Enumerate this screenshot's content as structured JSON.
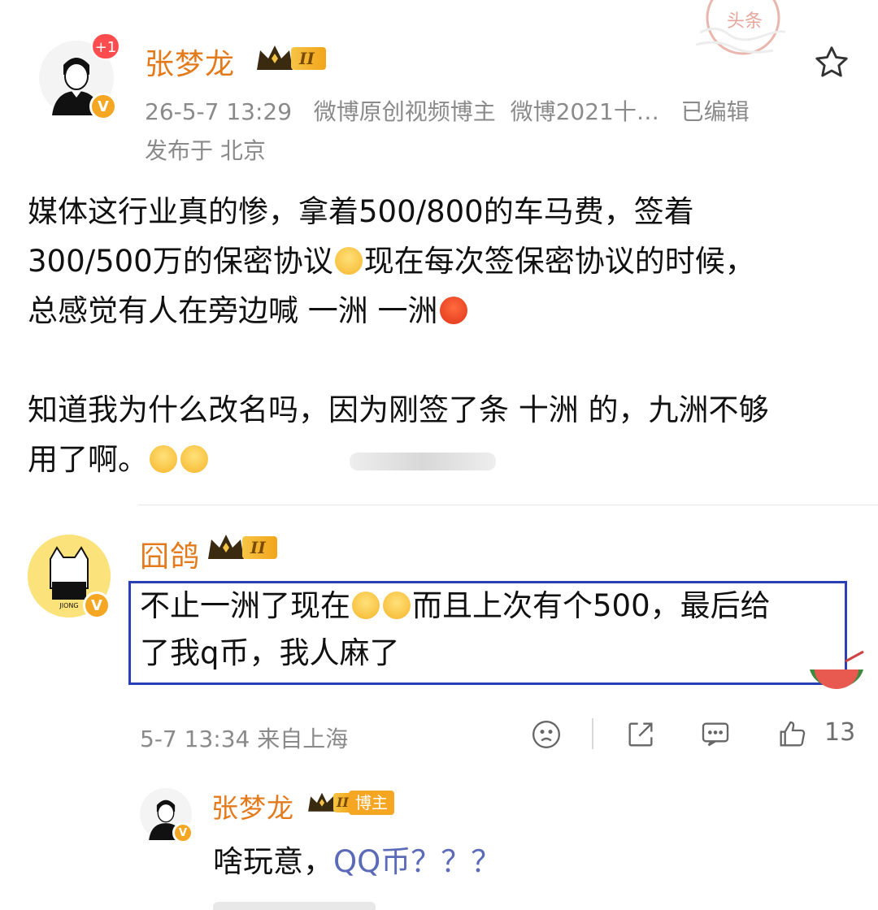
{
  "post": {
    "author": "张梦龙",
    "level": "II",
    "notification": "+1",
    "time": "26-5-7 13:29",
    "tag1": "微博原创视频博主",
    "tag2": "微博2021十…",
    "edited": "已编辑",
    "location": "发布于 北京",
    "para1_a": "媒体这行业真的惨，拿着500/800的车马费，签着",
    "para1_b": "300/500万的保密协议",
    "para1_c": "现在每次签保密协议的时候，",
    "para1_d": "总感觉有人在旁边喊 一洲 一洲",
    "para2_a": "知道我为什么改名吗，因为刚签了条 十洲 的，九洲不够",
    "para2_b": "用了啊。",
    "watermark": "头条"
  },
  "comment": {
    "author": "囧鸽",
    "level": "II",
    "text_a": "不止一洲了现在",
    "text_b": "而且上次有个500，最后给",
    "text_c": "了我q币，我人麻了",
    "time": "5-7 13:34 来自上海",
    "likes": "13"
  },
  "reply": {
    "author": "张梦龙",
    "level": "II",
    "badge": "博主",
    "text": "啥玩意，",
    "link": "QQ币？？？"
  },
  "colors": {
    "username": "#e37b1c",
    "highlight_border": "#2a3fb5",
    "link": "#5b6bb8"
  },
  "icons": [
    "star-icon",
    "sad-face-icon",
    "share-icon",
    "comment-icon",
    "like-icon",
    "verified-icon",
    "crown-icon"
  ]
}
